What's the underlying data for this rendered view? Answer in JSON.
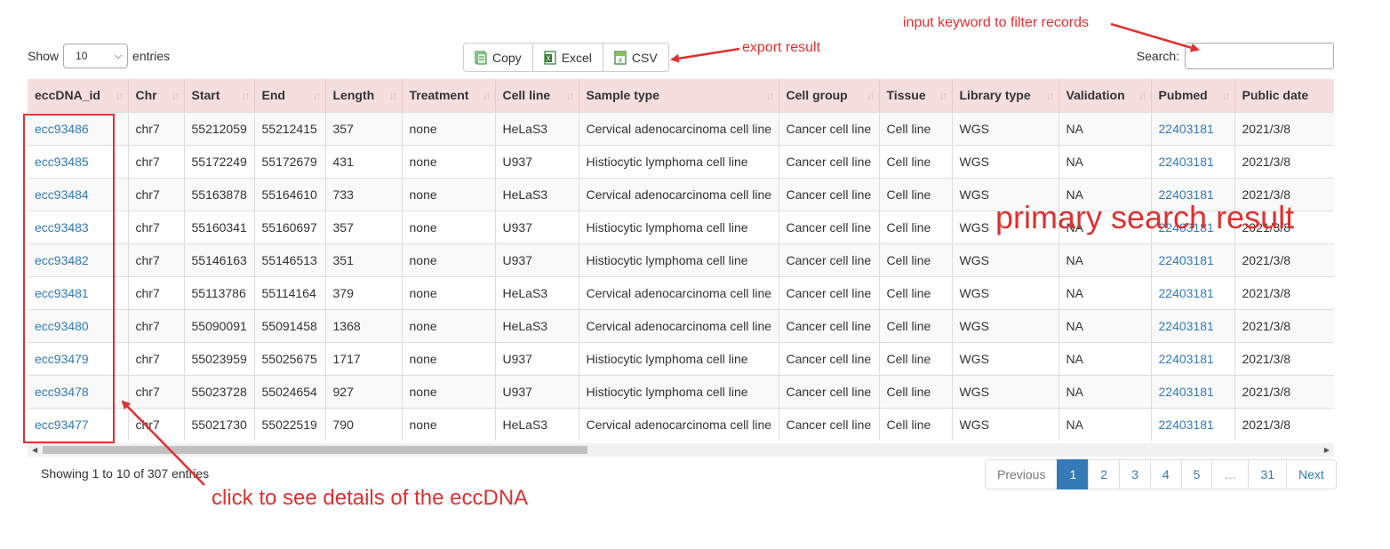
{
  "controls": {
    "show_label": "Show",
    "entries_value": "10",
    "entries_label": "entries",
    "search_label": "Search:",
    "search_value": "",
    "buttons": [
      {
        "label": "Copy",
        "icon": "copy-icon"
      },
      {
        "label": "Excel",
        "icon": "excel-icon"
      },
      {
        "label": "CSV",
        "icon": "csv-icon"
      }
    ]
  },
  "table": {
    "columns": [
      "eccDNA_id",
      "Chr",
      "Start",
      "End",
      "Length",
      "Treatment",
      "Cell line",
      "Sample type",
      "Cell group",
      "Tissue",
      "Library type",
      "Validation",
      "Pubmed",
      "Public date"
    ],
    "rows": [
      [
        "ecc93486",
        "chr7",
        "55212059",
        "55212415",
        "357",
        "none",
        "HeLaS3",
        "Cervical adenocarcinoma cell line",
        "Cancer cell line",
        "Cell line",
        "WGS",
        "NA",
        "22403181",
        "2021/3/8"
      ],
      [
        "ecc93485",
        "chr7",
        "55172249",
        "55172679",
        "431",
        "none",
        "U937",
        "Histiocytic lymphoma cell line",
        "Cancer cell line",
        "Cell line",
        "WGS",
        "NA",
        "22403181",
        "2021/3/8"
      ],
      [
        "ecc93484",
        "chr7",
        "55163878",
        "55164610",
        "733",
        "none",
        "HeLaS3",
        "Cervical adenocarcinoma cell line",
        "Cancer cell line",
        "Cell line",
        "WGS",
        "NA",
        "22403181",
        "2021/3/8"
      ],
      [
        "ecc93483",
        "chr7",
        "55160341",
        "55160697",
        "357",
        "none",
        "U937",
        "Histiocytic lymphoma cell line",
        "Cancer cell line",
        "Cell line",
        "WGS",
        "NA",
        "22403181",
        "2021/3/8"
      ],
      [
        "ecc93482",
        "chr7",
        "55146163",
        "55146513",
        "351",
        "none",
        "U937",
        "Histiocytic lymphoma cell line",
        "Cancer cell line",
        "Cell line",
        "WGS",
        "NA",
        "22403181",
        "2021/3/8"
      ],
      [
        "ecc93481",
        "chr7",
        "55113786",
        "55114164",
        "379",
        "none",
        "HeLaS3",
        "Cervical adenocarcinoma cell line",
        "Cancer cell line",
        "Cell line",
        "WGS",
        "NA",
        "22403181",
        "2021/3/8"
      ],
      [
        "ecc93480",
        "chr7",
        "55090091",
        "55091458",
        "1368",
        "none",
        "HeLaS3",
        "Cervical adenocarcinoma cell line",
        "Cancer cell line",
        "Cell line",
        "WGS",
        "NA",
        "22403181",
        "2021/3/8"
      ],
      [
        "ecc93479",
        "chr7",
        "55023959",
        "55025675",
        "1717",
        "none",
        "U937",
        "Histiocytic lymphoma cell line",
        "Cancer cell line",
        "Cell line",
        "WGS",
        "NA",
        "22403181",
        "2021/3/8"
      ],
      [
        "ecc93478",
        "chr7",
        "55023728",
        "55024654",
        "927",
        "none",
        "U937",
        "Histiocytic lymphoma cell line",
        "Cancer cell line",
        "Cell line",
        "WGS",
        "NA",
        "22403181",
        "2021/3/8"
      ],
      [
        "ecc93477",
        "chr7",
        "55021730",
        "55022519",
        "790",
        "none",
        "HeLaS3",
        "Cervical adenocarcinoma cell line",
        "Cancer cell line",
        "Cell line",
        "WGS",
        "NA",
        "22403181",
        "2021/3/8"
      ]
    ]
  },
  "footer": {
    "info": "Showing 1 to 10 of 307 entries",
    "pagination": [
      "Previous",
      "1",
      "2",
      "3",
      "4",
      "5",
      "…",
      "31",
      "Next"
    ],
    "active_page": "1"
  },
  "annotations": {
    "filter": "input keyword to filter records",
    "export": "export result",
    "primary": "primary search result",
    "click": "click to see details of the eccDNA",
    "color": "#e03030"
  }
}
